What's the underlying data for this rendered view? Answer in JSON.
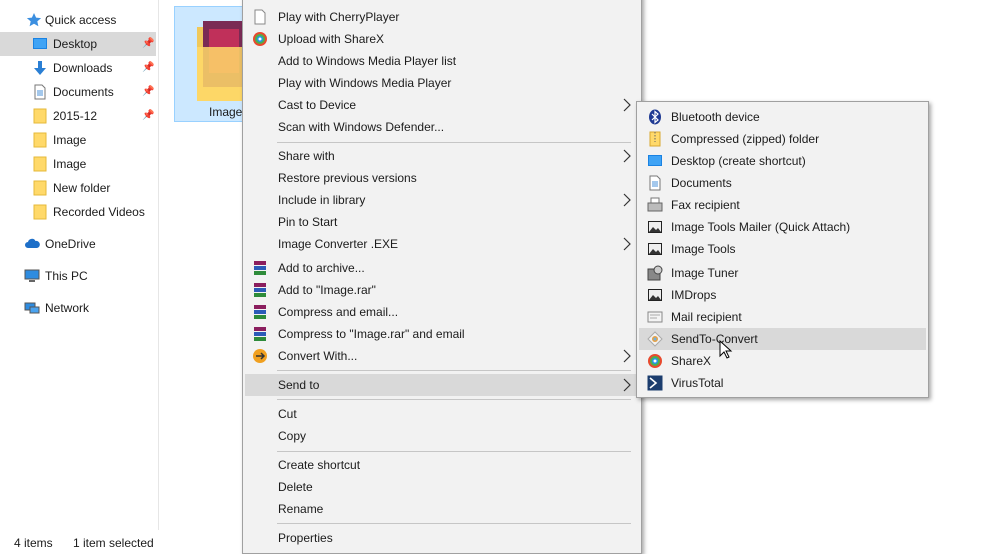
{
  "nav": {
    "quick_access": "Quick access",
    "items": [
      {
        "label": "Desktop",
        "pinned": true
      },
      {
        "label": "Downloads",
        "pinned": true
      },
      {
        "label": "Documents",
        "pinned": true
      },
      {
        "label": "2015-12",
        "pinned": true
      },
      {
        "label": "Image",
        "pinned": false
      },
      {
        "label": "Image",
        "pinned": false
      },
      {
        "label": "New folder",
        "pinned": false
      },
      {
        "label": "Recorded Videos",
        "pinned": false
      }
    ],
    "onedrive": "OneDrive",
    "this_pc": "This PC",
    "network": "Network"
  },
  "content": {
    "tile_caption": "Image"
  },
  "status": {
    "item_count": "4 items",
    "selection": "1 item selected"
  },
  "context_menu": {
    "items": [
      {
        "label": "Play with CherryPlayer",
        "icon": "document-icon"
      },
      {
        "label": "Upload with ShareX",
        "icon": "sharex-icon"
      },
      {
        "label": "Add to Windows Media Player list"
      },
      {
        "label": "Play with Windows Media Player"
      },
      {
        "label": "Cast to Device",
        "submenu": true
      },
      {
        "label": "Scan with Windows Defender..."
      },
      {
        "label": "Share with",
        "submenu": true
      },
      {
        "label": "Restore previous versions"
      },
      {
        "label": "Include in library",
        "submenu": true
      },
      {
        "label": "Pin to Start"
      },
      {
        "label": "Image Converter .EXE",
        "submenu": true
      },
      {
        "label": "Add to archive...",
        "icon": "winrar-icon"
      },
      {
        "label": "Add to \"Image.rar\"",
        "icon": "winrar-icon"
      },
      {
        "label": "Compress and email...",
        "icon": "winrar-icon"
      },
      {
        "label": "Compress to \"Image.rar\" and email",
        "icon": "winrar-icon"
      },
      {
        "label": "Convert With...",
        "icon": "convert-icon",
        "submenu": true
      },
      {
        "label": "Send to",
        "submenu": true,
        "highlighted": true
      },
      {
        "label": "Cut"
      },
      {
        "label": "Copy"
      },
      {
        "label": "Create shortcut"
      },
      {
        "label": "Delete"
      },
      {
        "label": "Rename"
      },
      {
        "label": "Properties"
      }
    ]
  },
  "send_to_menu": {
    "items": [
      {
        "label": "Bluetooth device",
        "icon": "bluetooth-icon"
      },
      {
        "label": "Compressed (zipped) folder",
        "icon": "zip-folder-icon"
      },
      {
        "label": "Desktop (create shortcut)",
        "icon": "desktop-icon"
      },
      {
        "label": "Documents",
        "icon": "documents-icon"
      },
      {
        "label": "Fax recipient",
        "icon": "fax-icon"
      },
      {
        "label": "Image Tools Mailer (Quick Attach)",
        "icon": "image-icon"
      },
      {
        "label": "Image Tools",
        "icon": "image-icon"
      },
      {
        "label": "Image Tuner",
        "icon": "image-tuner-icon"
      },
      {
        "label": "IMDrops",
        "icon": "image-icon"
      },
      {
        "label": "Mail recipient",
        "icon": "mail-icon"
      },
      {
        "label": "SendTo-Convert",
        "icon": "sendto-convert-icon",
        "highlighted": true
      },
      {
        "label": "ShareX",
        "icon": "sharex-icon"
      },
      {
        "label": "VirusTotal",
        "icon": "virustotal-icon"
      }
    ]
  },
  "colors": {
    "selection": "#cce8ff",
    "menu_bg": "#f2f2f2",
    "menu_highlight": "#d9d9d9",
    "folder": "#ffd96a",
    "accent": "#0078d7"
  }
}
